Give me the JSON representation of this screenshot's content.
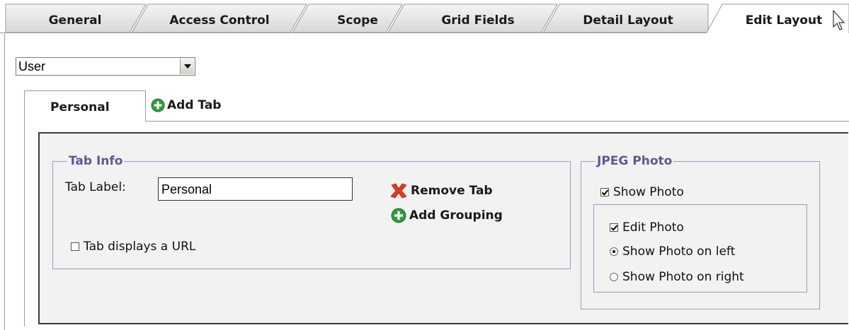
{
  "top_tabs": [
    {
      "label": "General",
      "active": false
    },
    {
      "label": "Access Control",
      "active": false
    },
    {
      "label": "Scope",
      "active": false
    },
    {
      "label": "Grid Fields",
      "active": false
    },
    {
      "label": "Detail Layout",
      "active": false
    },
    {
      "label": "Edit Layout",
      "active": true
    }
  ],
  "object_select": {
    "value": "User"
  },
  "inner_tabs": {
    "active_label": "Personal",
    "add_tab_label": "Add Tab"
  },
  "tab_info": {
    "legend": "Tab Info",
    "label_caption": "Tab Label:",
    "label_value": "Personal",
    "remove_tab": "Remove Tab",
    "add_grouping": "Add Grouping",
    "url_checkbox_label": "Tab displays a URL",
    "url_checked": false
  },
  "jpeg_photo": {
    "legend": "JPEG Photo",
    "show_photo_label": "Show Photo",
    "show_photo_checked": true,
    "edit_photo_label": "Edit Photo",
    "edit_photo_checked": true,
    "show_left_label": "Show Photo on left",
    "show_right_label": "Show Photo on right",
    "position_selected": "left"
  },
  "colors": {
    "tab_fill": "#e6e6e6",
    "legend_text": "#5a5a96",
    "panel_bg": "#f2f2f2",
    "add_icon_green": "#2e9e3a",
    "remove_icon_red": "#e03a1c"
  }
}
